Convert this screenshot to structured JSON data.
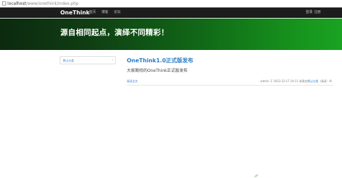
{
  "browser": {
    "url_host": "localhost",
    "url_path": "/www/onethink/index.php"
  },
  "navbar": {
    "brand": "OneThink",
    "items": [
      "首页",
      "博客",
      "论坛"
    ],
    "login": "登录",
    "register": "注册"
  },
  "hero": {
    "title": "源自相同起点，演绎不同精彩！"
  },
  "sidebar": {
    "category_label": "默认分类",
    "chevron": "›"
  },
  "article": {
    "title": "OneThink1.0正式版发布",
    "summary": "大家期待的OneThink正式版发布",
    "read_more": "阅读全文",
    "meta_prefix": "admin 于 2013-12-17 14:11 发表在",
    "meta_category": "默认分类",
    "meta_suffix": "（阅读：9）"
  },
  "colors": {
    "navbar_bg": "#1d1d1d",
    "hero_dark": "#0c2a0f",
    "hero_light": "#1aa322",
    "link": "#2a7cc7"
  },
  "icons": {
    "url_icon": "lock-icon",
    "watermark": "leaf-icon"
  }
}
